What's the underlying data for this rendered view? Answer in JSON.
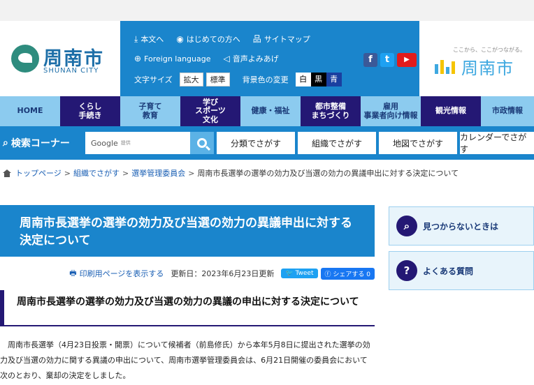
{
  "header": {
    "logo_text": "周南市",
    "logo_sub": "SHUNAN CITY",
    "util_links": [
      "本文へ",
      "はじめての方へ",
      "サイトマップ"
    ],
    "foreign_language": "Foreign language",
    "read_aloud": "音声よみあげ",
    "font_size_label": "文字サイズ",
    "font_size_buttons": [
      "拡大",
      "標準"
    ],
    "bg_color_label": "背景色の変更",
    "bg_color_buttons": [
      "白",
      "黒",
      "青"
    ],
    "social": [
      "f",
      "t",
      "▶"
    ],
    "brand_tagline": "ここから、ここがつながる。",
    "brand_name": "周南市"
  },
  "global_nav": [
    {
      "label": "HOME",
      "style": "light"
    },
    {
      "label": "くらし\n手続き",
      "style": "dark"
    },
    {
      "label": "子育て\n教育",
      "style": "light"
    },
    {
      "label": "学び\nスポーツ\n文化",
      "style": "dark"
    },
    {
      "label": "健康・福祉",
      "style": "light"
    },
    {
      "label": "都市整備\nまちづくり",
      "style": "dark"
    },
    {
      "label": "雇用\n事業者向け情報",
      "style": "light"
    },
    {
      "label": "観光情報",
      "style": "dark"
    },
    {
      "label": "市政情報",
      "style": "light"
    }
  ],
  "search": {
    "label": "検索コーナー",
    "google_text": "Google",
    "google_sub": "提供",
    "nav": [
      "分類でさがす",
      "組織でさがす",
      "地図でさがす",
      "カレンダーでさがす"
    ]
  },
  "breadcrumb": {
    "items": [
      "トップページ",
      "組織でさがす",
      "選挙管理委員会"
    ],
    "current": "周南市長選挙の選挙の効力及び当選の効力の異議申出に対する決定について"
  },
  "article": {
    "title": "周南市長選挙の選挙の効力及び当選の効力の異議申出に対する決定について",
    "print_link": "印刷用ページを表示する",
    "updated": "更新日：2023年6月23日更新",
    "tweet": "Tweet",
    "share": "シェアする",
    "share_count": "0",
    "heading": "周南市長選挙の選挙の効力及び当選の効力の異議の申出に対する決定について",
    "body": "周南市長選挙（4月23日投票・開票）について候補者（前島修氏）から本年5月8日に提出された選挙の効力及び当選の効力に関する異議の申出について、周南市選挙管理委員会は、6月21日開催の委員会において次のとおり、棄却の決定をしました。"
  },
  "sidebar": {
    "not_found": "見つからないときは",
    "faq": "よくある質問"
  },
  "colors": {
    "primary_blue": "#1a85cc",
    "navy": "#241874",
    "light_blue": "#8ccbef"
  }
}
